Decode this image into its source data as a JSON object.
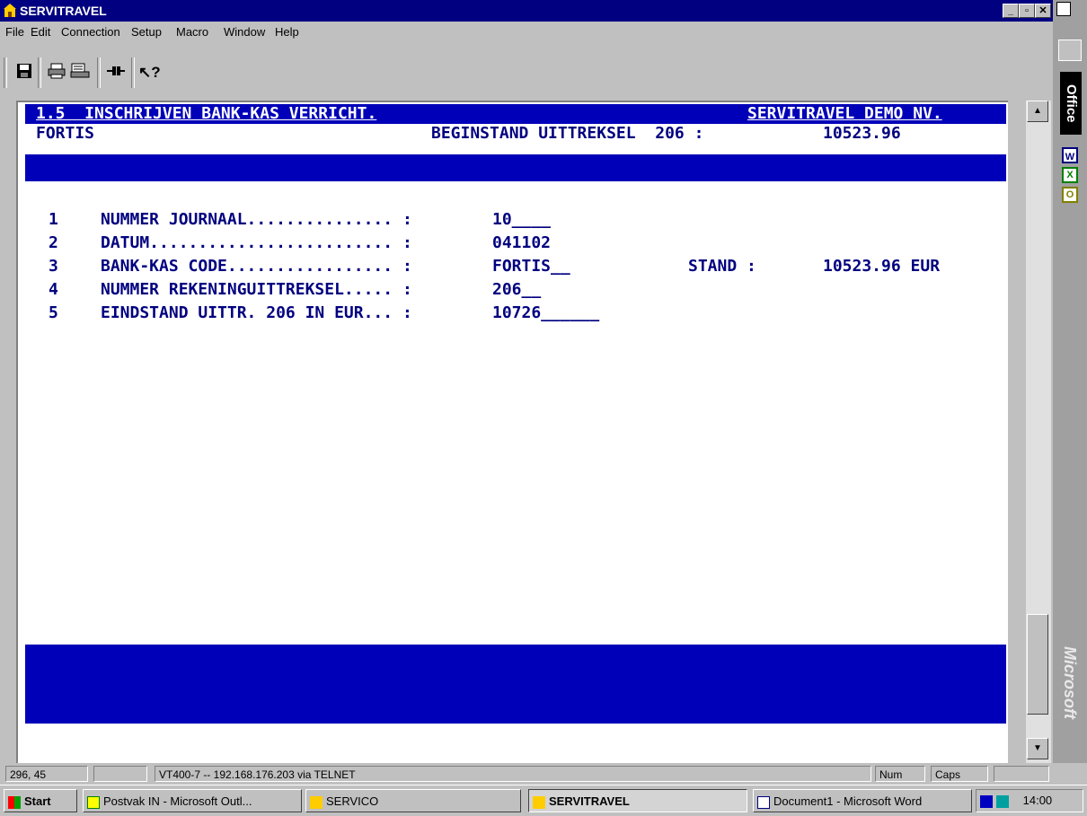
{
  "window": {
    "title": "SERVITRAVEL"
  },
  "menu": [
    "File",
    "Edit",
    "Connection",
    "Setup",
    "Macro",
    "Window",
    "Help"
  ],
  "terminal": {
    "header_left": "1.5  INSCHRIJVEN BANK-KAS VERRICHT.",
    "header_right": "SERVITRAVEL DEMO NV.",
    "sub_left": "FORTIS",
    "sub_middle": "BEGINSTAND UITTREKSEL  206 :",
    "sub_value": "10523.96",
    "fields": [
      {
        "num": "1",
        "label": "NUMMER JOURNAAL............... :",
        "value": "10____",
        "extra_label": "",
        "extra_value": ""
      },
      {
        "num": "2",
        "label": "DATUM......................... :",
        "value": "041102",
        "extra_label": "",
        "extra_value": ""
      },
      {
        "num": "3",
        "label": "BANK-KAS CODE................. :",
        "value": "FORTIS__",
        "extra_label": "STAND :",
        "extra_value": "10523.96 EUR"
      },
      {
        "num": "4",
        "label": "NUMMER REKENINGUITTREKSEL..... :",
        "value": "206__",
        "extra_label": "",
        "extra_value": ""
      },
      {
        "num": "5",
        "label": "EINDSTAND UITTR. 206 IN EUR... :",
        "value": "10726______",
        "extra_label": "",
        "extra_value": ""
      }
    ]
  },
  "statusbar": {
    "cursor": "296, 45",
    "connection": "VT400-7 -- 192.168.176.203 via TELNET",
    "num": "Num",
    "caps": "Caps"
  },
  "taskbar": {
    "start": "Start",
    "items": [
      "Postvak IN - Microsoft Outl...",
      "SERVICO",
      "SERVITRAVEL",
      "Document1 - Microsoft Word"
    ],
    "clock": "14:00"
  },
  "officebar": {
    "label": "Office",
    "brand": "Microsoft"
  }
}
